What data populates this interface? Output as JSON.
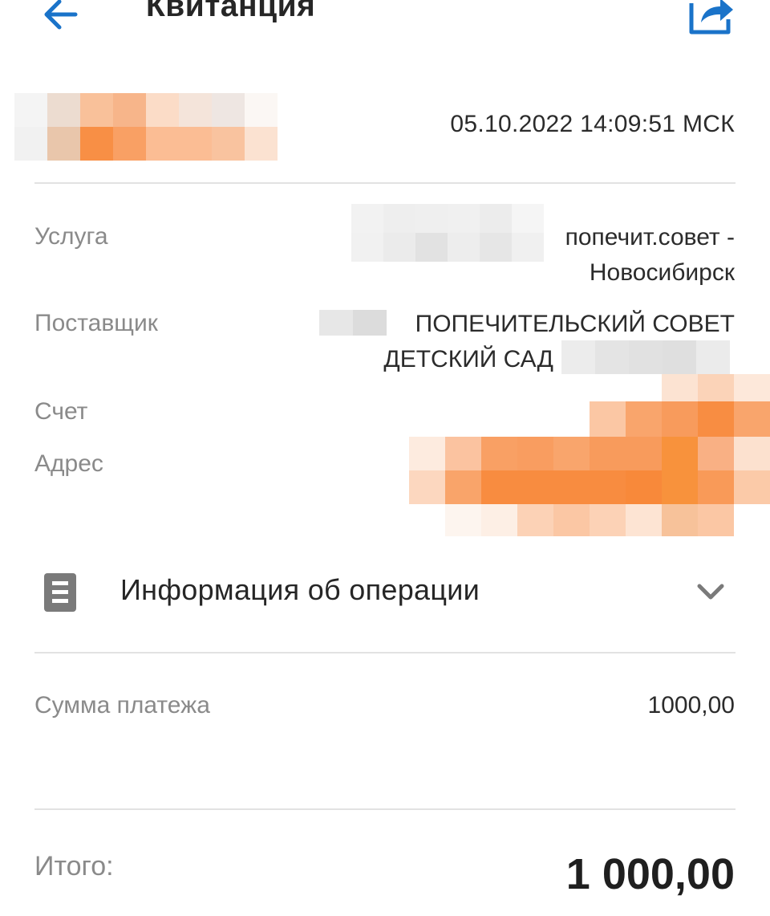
{
  "header": {
    "title": "Квитанция",
    "back_icon": "arrow-left-icon",
    "share_icon": "share-icon",
    "accent_color": "#1a73c9"
  },
  "receipt": {
    "datetime": "05.10.2022 14:09:51 МСК",
    "service_label": "Услуга",
    "service_value_line1": "попечит.совет -",
    "service_value_line2": "Новосибирск",
    "provider_label": "Поставщик",
    "provider_value_line1": "ПОПЕЧИТЕЛЬСКИЙ СОВЕТ",
    "provider_value_line2": "ДЕТСКИЙ САД",
    "account_label": "Счет",
    "address_label": "Адрес"
  },
  "operation_info": {
    "label": "Информация об операции",
    "icon": "document-icon",
    "chevron": "chevron-down-icon"
  },
  "payment": {
    "amount_label": "Сумма платежа",
    "amount_value": "1000,00",
    "total_label": "Итого:",
    "total_value": "1 000,00"
  }
}
